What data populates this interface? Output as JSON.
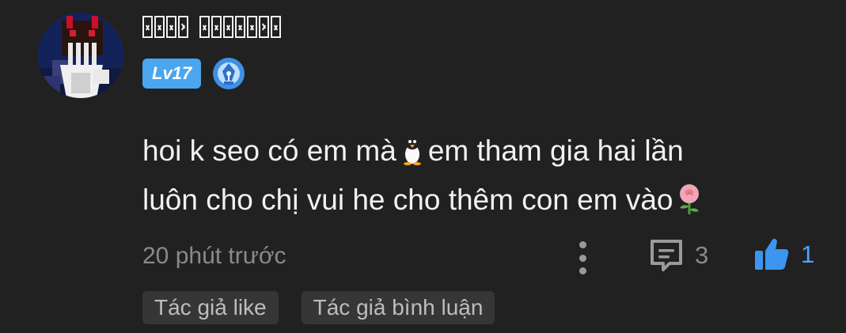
{
  "user": {
    "avatar_icon": "minecraft-skin-avatar",
    "name_words": [
      {
        "glyphs": [
          "box",
          "box",
          "box",
          "tilde"
        ]
      },
      {
        "glyphs": [
          "box",
          "box",
          "box",
          "box",
          "box",
          "tilde",
          "box"
        ]
      }
    ],
    "level_label": "Lv17",
    "creator_badge_icon": "pen-nib-icon"
  },
  "comment": {
    "text_part1": "hoi k seo có em mà",
    "emoji1": "penguin-emoji",
    "text_part2": "em tham gia hai lần",
    "text_part3": "luôn cho chị vui he cho thêm con em vào",
    "emoji2": "rose-emoji"
  },
  "meta": {
    "time_ago": "20 phút trước",
    "reply_count": "3",
    "like_count": "1",
    "more_icon": "more-vertical-icon",
    "reply_icon": "comment-icon",
    "like_icon": "thumbs-up-icon"
  },
  "tags": {
    "author_liked": "Tác giả like",
    "author_replied": "Tác giả bình luận"
  },
  "colors": {
    "background": "#212121",
    "accent_blue": "#4aa3ff",
    "muted": "#8a8a8a",
    "tag_bg": "#363636"
  }
}
